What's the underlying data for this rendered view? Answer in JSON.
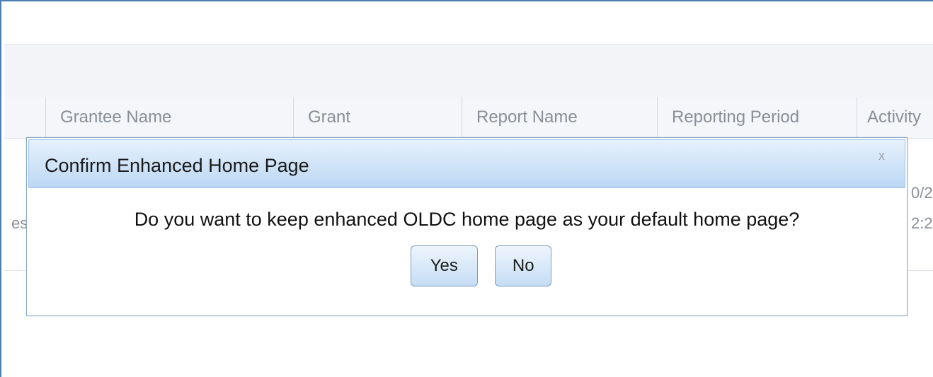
{
  "grid": {
    "columns": [
      "Grantee Name",
      "Grant",
      "Report Name",
      "Reporting Period",
      "Activity"
    ],
    "peek_left": "es",
    "peek_right_1": "0/2",
    "peek_right_2": "2:2"
  },
  "dialog": {
    "title": "Confirm Enhanced Home Page",
    "close_glyph": "x",
    "message": "Do you want to keep enhanced OLDC home page as your default home page?",
    "yes_label": "Yes",
    "no_label": "No"
  },
  "colors": {
    "frame_border": "#4a7fb5",
    "dialog_header_top": "#e6f1fc",
    "dialog_header_bottom": "#bcd8f4",
    "button_border": "#7a9cc2"
  }
}
